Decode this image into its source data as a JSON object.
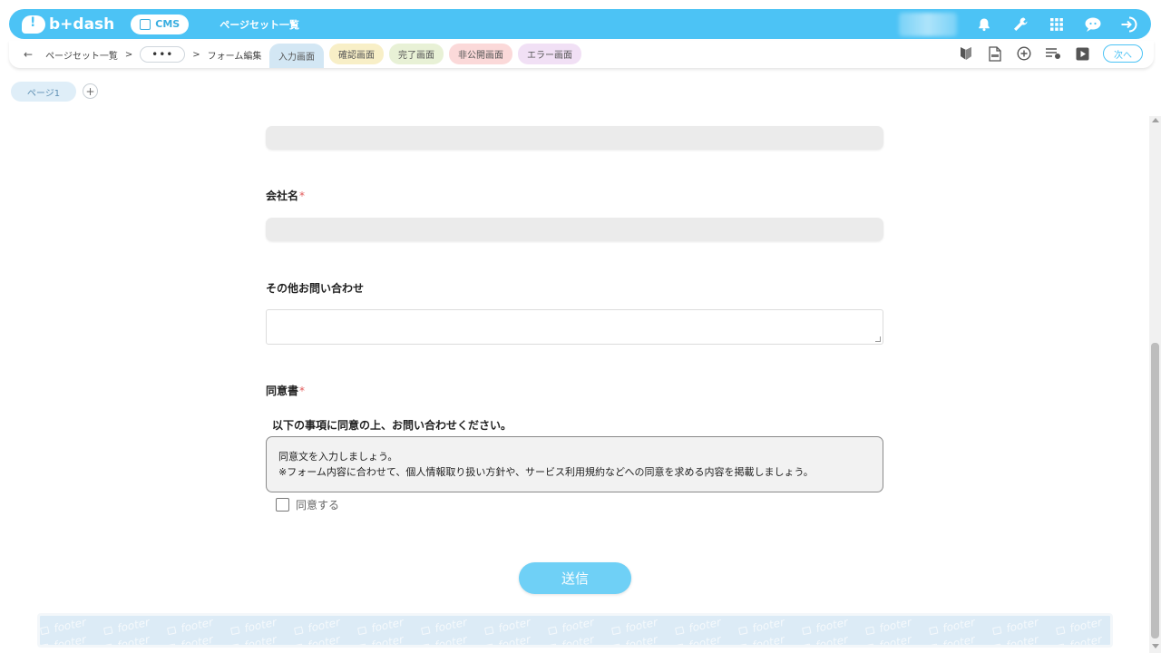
{
  "topbar": {
    "logo_text": "b+dash",
    "cms_label": "CMS",
    "title": "ページセット一覧"
  },
  "subbar": {
    "crumb_list": "ページセット一覧",
    "crumb_sep1": ">",
    "crumb_dots": "•••",
    "crumb_sep2": ">",
    "crumb_current": "フォーム編集",
    "tabs": [
      {
        "label": "入力画面"
      },
      {
        "label": "確認画面"
      },
      {
        "label": "完了画面"
      },
      {
        "label": "非公開画面"
      },
      {
        "label": "エラー画面"
      }
    ],
    "next_label": "次へ"
  },
  "pages": {
    "page1": "ページ1",
    "add": "+"
  },
  "form": {
    "company_label": "会社名",
    "required_mark": "*",
    "other_label": "その他お問い合わせ",
    "consent_label": "同意書",
    "consent_intro": "以下の事項に同意の上、お問い合わせください。",
    "consent_line1": "同意文を入力しましょう。",
    "consent_line2": "※フォーム内容に合わせて、個人情報取り扱い方針や、サービス利用規約などへの同意を求める内容を掲載しましょう。",
    "agree_label": "同意する",
    "submit_label": "送信"
  },
  "footer": {
    "word": "footer"
  },
  "colors": {
    "brand": "#4cc3f5",
    "required": "#e25b5b",
    "submit": "#6fd0f6"
  }
}
